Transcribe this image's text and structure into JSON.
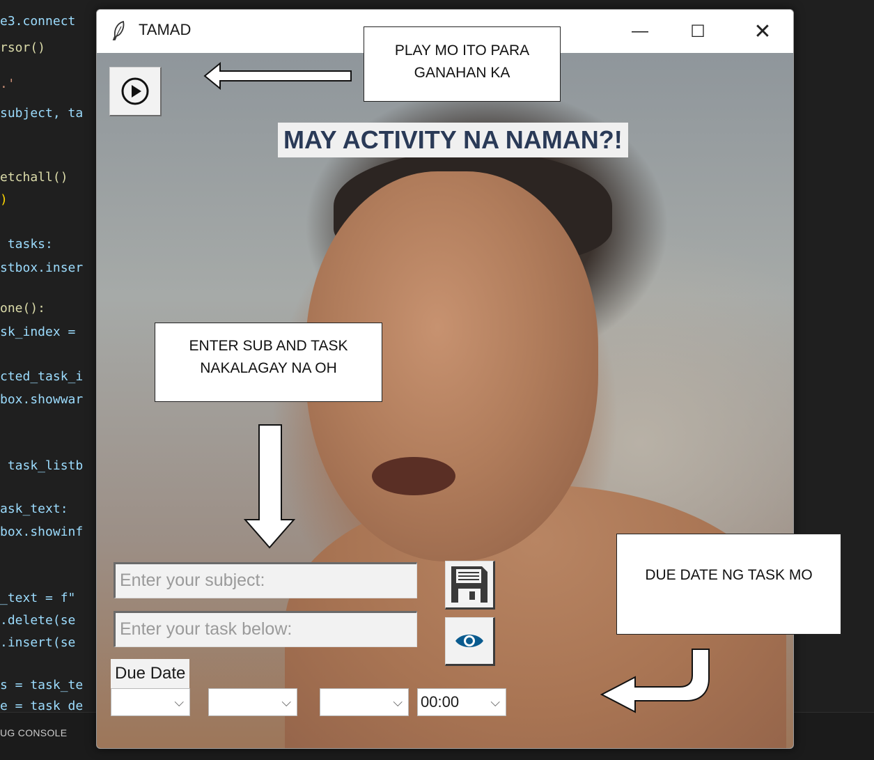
{
  "editor": {
    "code_lines": [
      {
        "text": "e3.connect",
        "color": "#9cdcfe"
      },
      {
        "text": "rsor()",
        "color": "#dcdcaa"
      },
      {
        "text": ".'",
        "color": "#ce9178"
      },
      {
        "text": "subject, ta",
        "color": "#9cdcfe"
      },
      {
        "text": "etchall()",
        "color": "#dcdcaa"
      },
      {
        "text": ")",
        "color": "#ffd700"
      },
      {
        "text": " tasks:",
        "color": "#9cdcfe"
      },
      {
        "text": "stbox.inser",
        "color": "#9cdcfe"
      },
      {
        "text": "one():",
        "color": "#dcdcaa"
      },
      {
        "text": "sk_index =",
        "color": "#9cdcfe"
      },
      {
        "text": "cted_task_i",
        "color": "#9cdcfe"
      },
      {
        "text": "box.showwar",
        "color": "#9cdcfe"
      },
      {
        "text": " task_listb",
        "color": "#9cdcfe"
      },
      {
        "text": "ask_text:",
        "color": "#9cdcfe"
      },
      {
        "text": "box.showinf",
        "color": "#9cdcfe"
      },
      {
        "text": "_text = f\"",
        "color": "#9cdcfe"
      },
      {
        "text": ".delete(se",
        "color": "#9cdcfe"
      },
      {
        "text": ".insert(se",
        "color": "#9cdcfe"
      },
      {
        "text": "s = task_te",
        "color": "#9cdcfe"
      },
      {
        "text": "e = task_de",
        "color": "#9cdcfe"
      }
    ],
    "console_label": "UG CONSOLE"
  },
  "window": {
    "title": "TAMAD",
    "minimize_glyph": "—",
    "maximize_glyph": "☐",
    "close_glyph": "✕"
  },
  "app": {
    "headline": "MAY ACTIVITY NA NAMAN?!",
    "subject_placeholder": "Enter your subject:",
    "task_placeholder": "Enter your task below:",
    "due_date_label": "Due Date",
    "combos": [
      {
        "value": ""
      },
      {
        "value": ""
      },
      {
        "value": ""
      },
      {
        "value": "00:00"
      }
    ],
    "chevron_glyph": "⌵"
  },
  "annotations": {
    "play_note_line1": "PLAY MO ITO PARA",
    "play_note_line2": "GANAHAN KA",
    "enter_note_line1": "ENTER SUB AND TASK",
    "enter_note_line2": "NAKALAGAY NA OH",
    "due_note": "DUE DATE NG TASK MO"
  },
  "colors": {
    "headline": "#2a3a57",
    "save_icon": "#3a3a3a",
    "eye_icon": "#0a5b8f"
  }
}
